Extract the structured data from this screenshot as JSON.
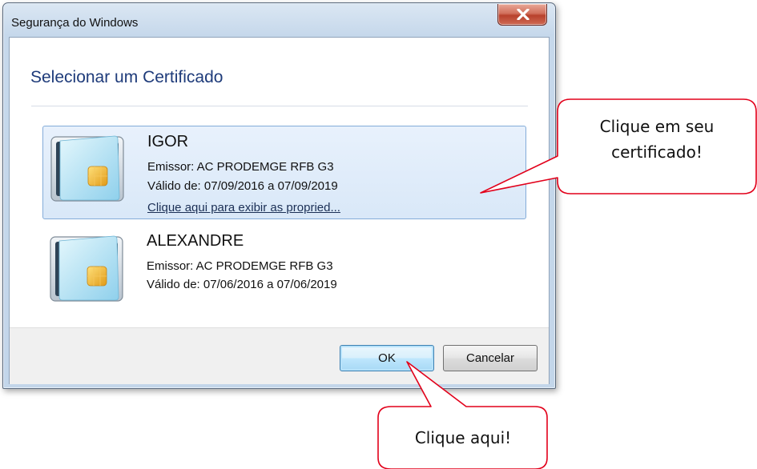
{
  "window": {
    "title": "Segurança do Windows",
    "close_icon": "close-x-icon"
  },
  "dialog": {
    "heading": "Selecionar um Certificado",
    "certificates": [
      {
        "name": "IGOR",
        "issuer": "Emissor: AC PRODEMGE RFB G3",
        "validity": "Válido de: 07/09/2016 a 07/09/2019",
        "link": "Clique aqui para exibir as propried...",
        "selected": true,
        "icon": "smart-card-icon"
      },
      {
        "name": "ALEXANDRE",
        "issuer": "Emissor: AC PRODEMGE RFB G3",
        "validity": "Válido de: 07/06/2016 a 07/06/2019",
        "selected": false,
        "icon": "smart-card-icon"
      }
    ],
    "buttons": {
      "ok": "OK",
      "cancel": "Cancelar"
    }
  },
  "callouts": {
    "certificate": {
      "line1": "Clique em seu",
      "line2": "certificado!"
    },
    "ok": {
      "text": "Clique aqui!"
    }
  },
  "colors": {
    "callout_border": "#e2001a",
    "heading": "#1e3b7a",
    "selection": "#d9e8f8"
  }
}
